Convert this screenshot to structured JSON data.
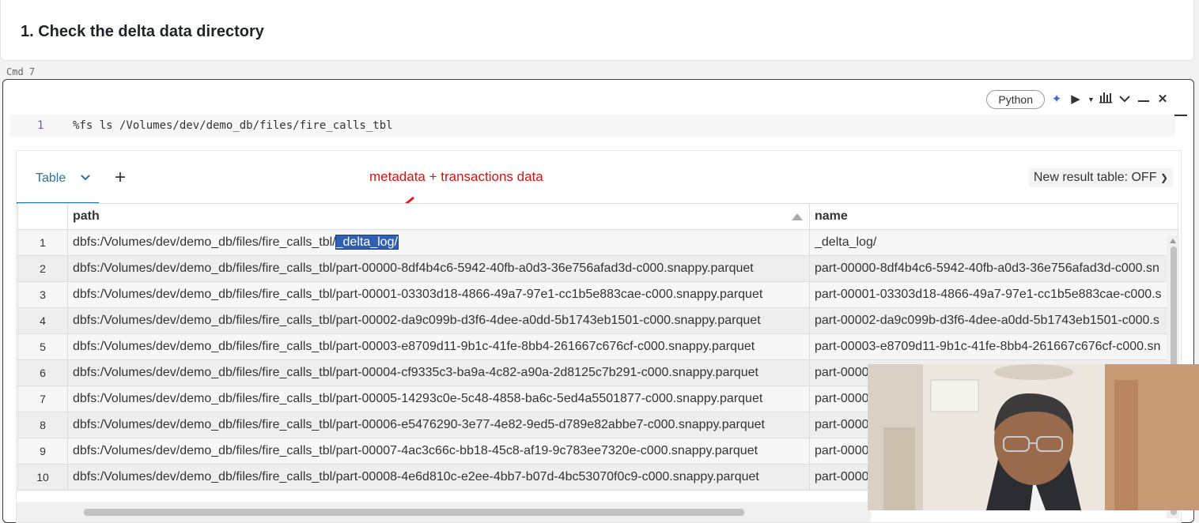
{
  "markdown_cell": {
    "title": "1. Check the delta data directory"
  },
  "cmd_label": "Cmd 7",
  "toolbar": {
    "language": "Python",
    "icons": [
      "sparkle-icon",
      "run-icon",
      "run-dropdown-icon",
      "chart-icon",
      "chevron-down-icon",
      "minimize-icon",
      "close-icon"
    ]
  },
  "code": {
    "line_number": "1",
    "text": "%fs ls /Volumes/dev/demo_db/files/fire_calls_tbl"
  },
  "result": {
    "tab_label": "Table",
    "add_label": "+",
    "new_result_label": "New result table: OFF",
    "annotation": "metadata + transactions data",
    "columns": [
      "path",
      "name"
    ],
    "rows": [
      {
        "n": "1",
        "path_prefix": "dbfs:/Volumes/dev/demo_db/files/fire_calls_tbl/",
        "path_highlight": "_delta_log/",
        "name": "_delta_log/"
      },
      {
        "n": "2",
        "path": "dbfs:/Volumes/dev/demo_db/files/fire_calls_tbl/part-00000-8df4b4c6-5942-40fb-a0d3-36e756afad3d-c000.snappy.parquet",
        "name": "part-00000-8df4b4c6-5942-40fb-a0d3-36e756afad3d-c000.sn"
      },
      {
        "n": "3",
        "path": "dbfs:/Volumes/dev/demo_db/files/fire_calls_tbl/part-00001-03303d18-4866-49a7-97e1-cc1b5e883cae-c000.snappy.parquet",
        "name": "part-00001-03303d18-4866-49a7-97e1-cc1b5e883cae-c000.s"
      },
      {
        "n": "4",
        "path": "dbfs:/Volumes/dev/demo_db/files/fire_calls_tbl/part-00002-da9c099b-d3f6-4dee-a0dd-5b1743eb1501-c000.snappy.parquet",
        "name": "part-00002-da9c099b-d3f6-4dee-a0dd-5b1743eb1501-c000.s"
      },
      {
        "n": "5",
        "path": "dbfs:/Volumes/dev/demo_db/files/fire_calls_tbl/part-00003-e8709d11-9b1c-41fe-8bb4-261667c676cf-c000.snappy.parquet",
        "name": "part-00003-e8709d11-9b1c-41fe-8bb4-261667c676cf-c000.sn"
      },
      {
        "n": "6",
        "path": "dbfs:/Volumes/dev/demo_db/files/fire_calls_tbl/part-00004-cf9335c3-ba9a-4c82-a90a-2d8125c7b291-c000.snappy.parquet",
        "name": "part-0000"
      },
      {
        "n": "7",
        "path": "dbfs:/Volumes/dev/demo_db/files/fire_calls_tbl/part-00005-14293c0e-5c48-4858-ba6c-5ed4a5501877-c000.snappy.parquet",
        "name": "part-0000"
      },
      {
        "n": "8",
        "path": "dbfs:/Volumes/dev/demo_db/files/fire_calls_tbl/part-00006-e5476290-3e77-4e82-9ed5-d789e82abbe7-c000.snappy.parquet",
        "name": "part-0000"
      },
      {
        "n": "9",
        "path": "dbfs:/Volumes/dev/demo_db/files/fire_calls_tbl/part-00007-4ac3c66c-bb18-45c8-af19-9c783ee7320e-c000.snappy.parquet",
        "name": "part-0000"
      },
      {
        "n": "10",
        "path": "dbfs:/Volumes/dev/demo_db/files/fire_calls_tbl/part-00008-4e6d810c-e2ee-4bb7-b07d-4bc53070f0c9-c000.snappy.parquet",
        "name": "part-0000"
      }
    ]
  },
  "colors": {
    "accent": "#2272b4",
    "annotation": "#d01515",
    "highlight": "#2f5fb2"
  }
}
